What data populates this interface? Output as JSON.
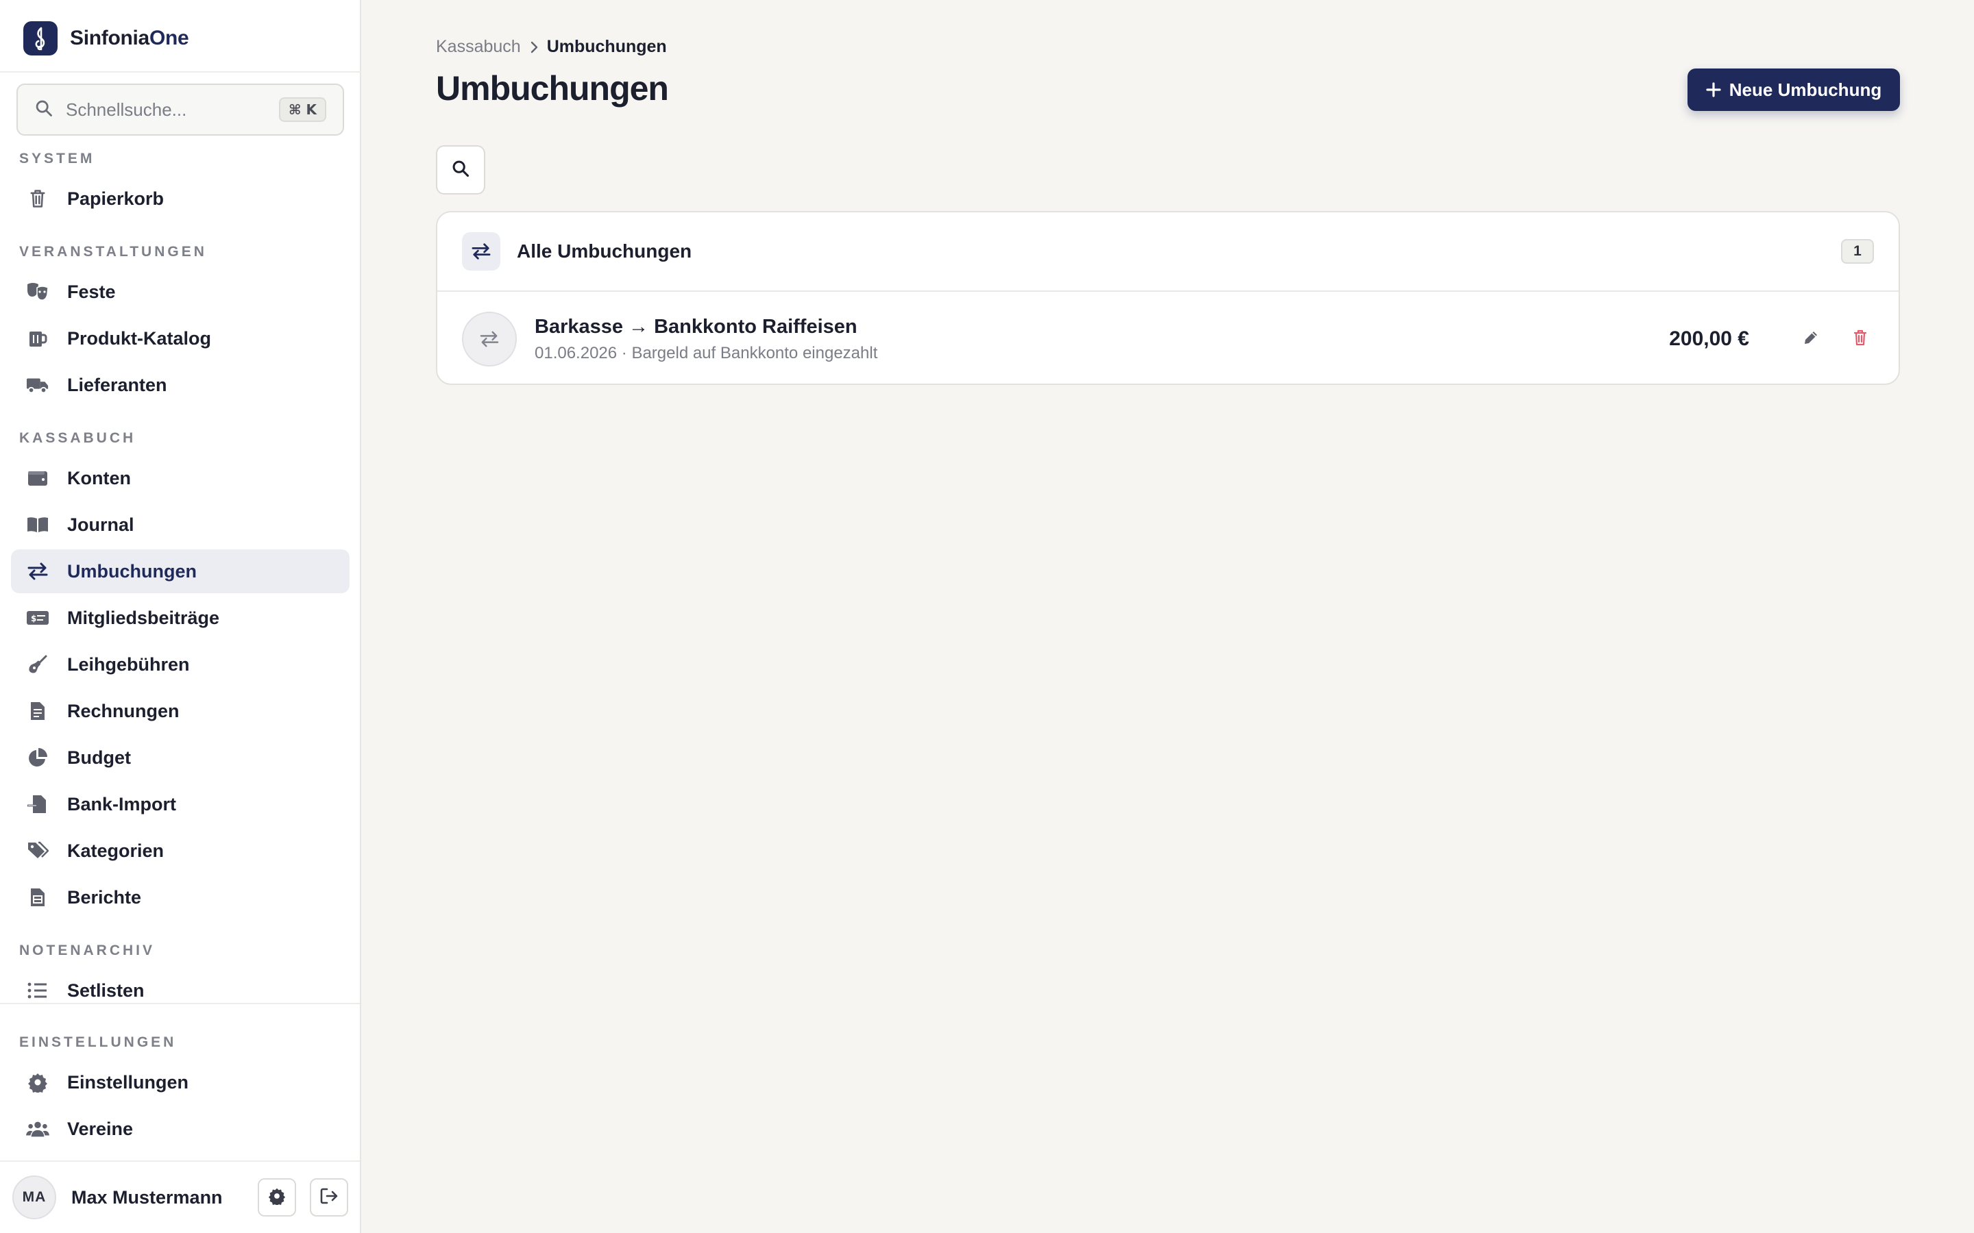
{
  "brand": {
    "name_main": "Sinfonia",
    "name_accent": "One"
  },
  "search": {
    "placeholder": "Schnellsuche...",
    "shortcut": "⌘ K"
  },
  "sidebar": {
    "sections": {
      "system": "SYSTEM",
      "veranstaltungen": "VERANSTALTUNGEN",
      "kassabuch": "KASSABUCH",
      "notenarchiv": "NOTENARCHIV",
      "einstellungen": "EINSTELLUNGEN"
    },
    "items": {
      "papierkorb": "Papierkorb",
      "feste": "Feste",
      "produkt_katalog": "Produkt-Katalog",
      "lieferanten": "Lieferanten",
      "konten": "Konten",
      "journal": "Journal",
      "umbuchungen": "Umbuchungen",
      "mitgliedsbeitraege": "Mitgliedsbeiträge",
      "leihgebuehren": "Leihgebühren",
      "rechnungen": "Rechnungen",
      "budget": "Budget",
      "bank_import": "Bank-Import",
      "kategorien": "Kategorien",
      "berichte": "Berichte",
      "setlisten": "Setlisten",
      "einstellungen": "Einstellungen",
      "vereine": "Vereine"
    },
    "active_item": "umbuchungen",
    "icons": {
      "papierkorb": "trash-icon",
      "feste": "masks-icon",
      "produkt_katalog": "mug-icon",
      "lieferanten": "truck-icon",
      "konten": "wallet-icon",
      "journal": "book-icon",
      "umbuchungen": "transfer-arrows-icon",
      "mitgliedsbeitraege": "money-card-icon",
      "leihgebuehren": "guitar-icon",
      "rechnungen": "invoice-icon",
      "budget": "pie-chart-icon",
      "bank_import": "file-import-icon",
      "kategorien": "tags-icon",
      "berichte": "report-icon",
      "setlisten": "list-icon",
      "einstellungen": "gear-icon",
      "vereine": "users-icon"
    }
  },
  "user": {
    "initials": "MA",
    "name": "Max Mustermann"
  },
  "breadcrumb": {
    "parent": "Kassabuch",
    "current": "Umbuchungen"
  },
  "page": {
    "title": "Umbuchungen",
    "new_button": "Neue Umbuchung"
  },
  "list": {
    "header": "Alle Umbuchungen",
    "count": "1",
    "rows": [
      {
        "title": "Barkasse → Bankkonto Raiffeisen",
        "subtitle": "01.06.2026 · Bargeld auf Bankkonto eingezahlt",
        "amount": "200,00 €"
      }
    ]
  },
  "colors": {
    "primary": "#1f2a5a",
    "danger": "#e45a6a",
    "background": "#f6f5f2",
    "muted_text": "#7b7d86"
  }
}
